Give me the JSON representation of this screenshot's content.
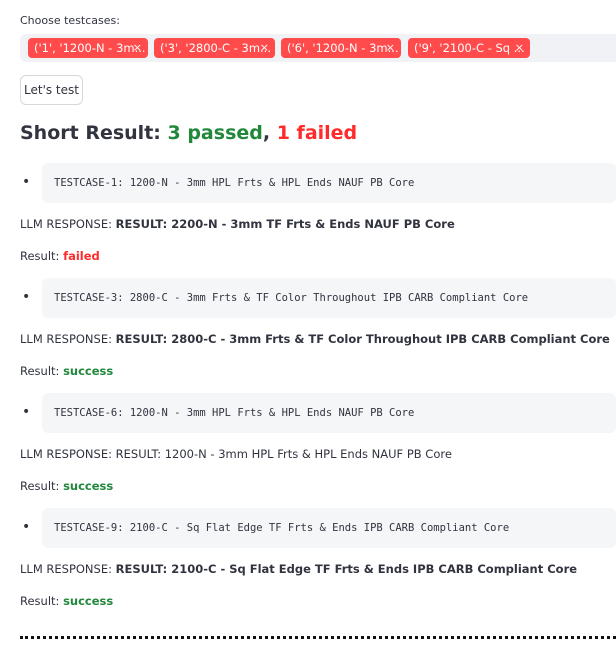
{
  "select_label": "Choose testcases:",
  "chips": [
    {
      "label": "('1', '1200-N - 3m...",
      "remove": "×"
    },
    {
      "label": "('3', '2800-C - 3m...",
      "remove": "×"
    },
    {
      "label": "('6', '1200-N - 3m...",
      "remove": "×"
    },
    {
      "label": "('9', '2100-C - Sq ...",
      "remove": "×"
    }
  ],
  "run_button": "Let's test",
  "summary": {
    "prefix": "Short Result: ",
    "passed": "3 passed",
    "sep": ", ",
    "failed": "1 failed"
  },
  "testcases": [
    {
      "bullet": "•",
      "code": "TESTCASE-1: 1200-N - 3mm HPL Frts & HPL Ends NAUF PB Core",
      "llm_label": "LLM RESPONSE: ",
      "llm_text": "RESULT: 2200-N - 3mm TF Frts & Ends NAUF PB Core",
      "llm_bold": true,
      "result_label": "Result: ",
      "result": "failed",
      "status_color": "#ff2b2b"
    },
    {
      "bullet": "•",
      "code": "TESTCASE-3: 2800-C - 3mm Frts & TF Color Throughout IPB CARB Compliant Core",
      "llm_label": "LLM RESPONSE: ",
      "llm_text": "RESULT: 2800-C - 3mm Frts & TF Color Throughout IPB CARB Compliant Core",
      "llm_bold": true,
      "result_label": "Result: ",
      "result": "success",
      "status_color": "#21883b"
    },
    {
      "bullet": "•",
      "code": "TESTCASE-6: 1200-N - 3mm HPL Frts & HPL Ends NAUF PB Core",
      "llm_label": "LLM RESPONSE: ",
      "llm_text": "RESULT: 1200-N - 3mm HPL Frts & HPL Ends NAUF PB Core",
      "llm_bold": false,
      "result_label": "Result: ",
      "result": "success",
      "status_color": "#21883b"
    },
    {
      "bullet": "•",
      "code": "TESTCASE-9: 2100-C - Sq Flat Edge TF Frts & Ends IPB CARB Compliant Core",
      "llm_label": "LLM RESPONSE: ",
      "llm_text": "RESULT: 2100-C - Sq Flat Edge TF Frts & Ends IPB CARB Compliant Core",
      "llm_bold": true,
      "result_label": "Result: ",
      "result": "success",
      "status_color": "#21883b"
    }
  ]
}
